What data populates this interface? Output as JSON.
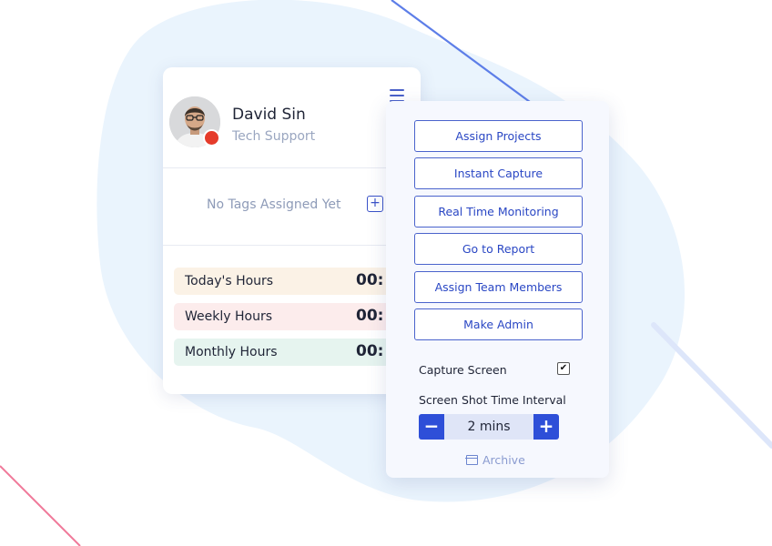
{
  "profile": {
    "name": "David Sin",
    "role": "Tech Support",
    "status_color": "#e53b2a",
    "menu_icon": "hamburger-icon"
  },
  "tags": {
    "empty_text": "No Tags Assigned Yet",
    "add_icon": "plus-square-icon"
  },
  "hours": [
    {
      "label": "Today's Hours",
      "value": "00:",
      "bg": "#fbf2e6"
    },
    {
      "label": "Weekly Hours",
      "value": "00:",
      "bg": "#fcecec"
    },
    {
      "label": "Monthly Hours",
      "value": "00:",
      "bg": "#e6f4ef"
    }
  ],
  "menu": {
    "items": [
      "Assign Projects",
      "Instant Capture",
      "Real Time Monitoring",
      "Go to Report",
      "Assign Team Members",
      "Make Admin"
    ],
    "capture_screen_label": "Capture Screen",
    "capture_screen_checked": true,
    "interval_label": "Screen Shot Time Interval",
    "interval_value": "2 mins",
    "archive_label": "Archive",
    "accent": "#2e4fd8"
  }
}
